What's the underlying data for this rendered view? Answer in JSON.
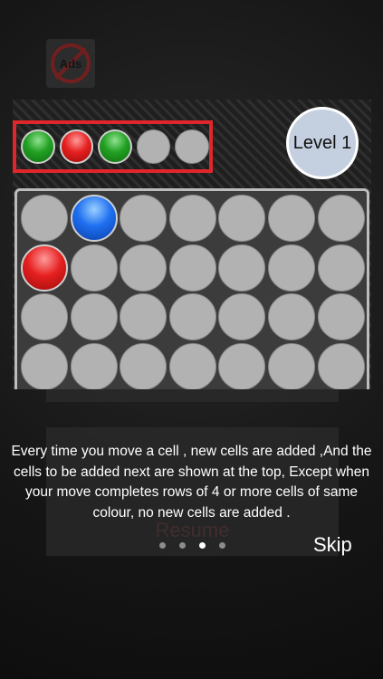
{
  "ads_button": {
    "label": "Ads"
  },
  "preview": {
    "level_label": "Level 1",
    "next_cells": [
      "green",
      "red",
      "green",
      "empty",
      "empty"
    ],
    "grid_columns": 7,
    "grid_rows": [
      [
        "empty",
        "blue",
        "empty",
        "empty",
        "empty",
        "empty",
        "empty"
      ],
      [
        "red",
        "empty",
        "empty",
        "empty",
        "empty",
        "empty",
        "empty"
      ],
      [
        "empty",
        "empty",
        "empty",
        "empty",
        "empty",
        "empty",
        "empty"
      ],
      [
        "empty",
        "empty",
        "empty",
        "empty",
        "empty",
        "empty",
        "empty"
      ]
    ]
  },
  "background_menu": {
    "resume_label": "Resume"
  },
  "tutorial": {
    "text": "Every time you move a cell , new cells are added ,And the cells to be added next are shown at the top, Except when your move completes rows of 4 or more cells of same colour, no new cells are added .",
    "page_count": 4,
    "current_page": 3,
    "skip_label": "Skip"
  },
  "colors": {
    "highlight_border": "#e0262a",
    "empty_cell": "#b2b2b2",
    "level_badge": "#c4cfe0"
  }
}
